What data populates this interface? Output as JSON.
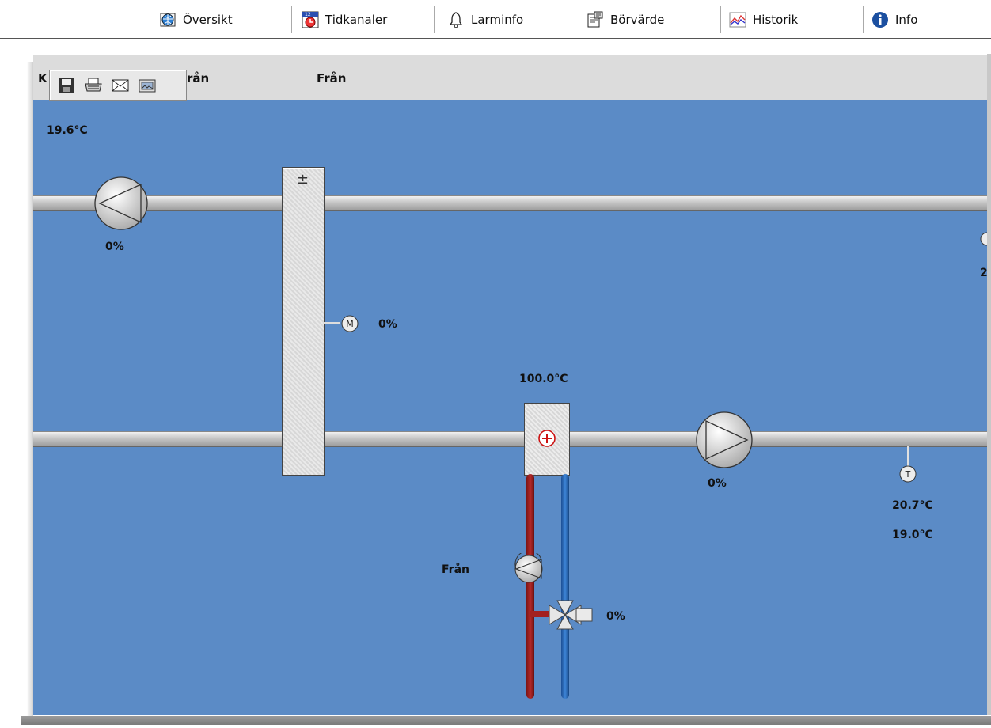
{
  "menu": {
    "items": [
      {
        "label": "Översikt",
        "icon": "globe-icon"
      },
      {
        "label": "Tidkanaler",
        "icon": "calendar-clock-icon"
      },
      {
        "label": "Larminfo",
        "icon": "bell-icon"
      },
      {
        "label": "Börvärde",
        "icon": "settings-sheet-icon"
      },
      {
        "label": "Historik",
        "icon": "trend-chart-icon"
      },
      {
        "label": "Info",
        "icon": "info-icon"
      }
    ]
  },
  "header": {
    "left_fragment": "K",
    "status1": "rån",
    "status2": "Från"
  },
  "toolbar": {
    "buttons": [
      "save-icon",
      "print-icon",
      "mail-icon",
      "image-icon"
    ]
  },
  "values": {
    "outdoor_temp": "19.6°C",
    "exhaust_fan_speed": "0%",
    "heat_exchanger_motor": "0%",
    "heater_temp": "100.0°C",
    "supply_fan_speed": "0%",
    "supply_temp": "20.7°C",
    "supply_setpoint": "19.0°C",
    "pump_status": "Från",
    "valve_position": "0%",
    "right_cut_value": "2"
  },
  "colors": {
    "canvas_bg": "#5b8bc6",
    "hot_pipe": "#b52a2a",
    "cold_pipe": "#3d84d6",
    "heater_cross": "#cc1111"
  }
}
